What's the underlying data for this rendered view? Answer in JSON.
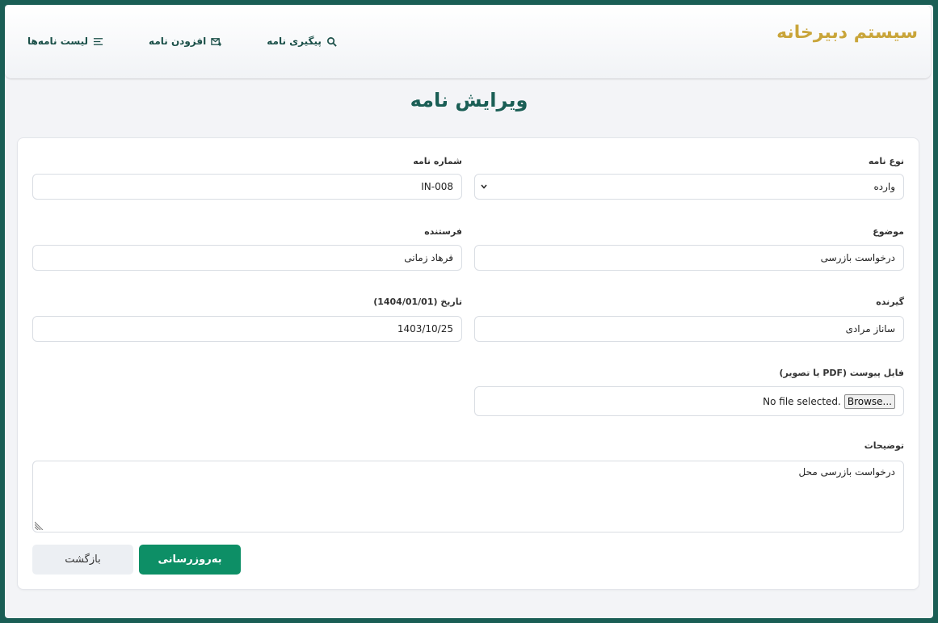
{
  "header": {
    "brand": "سیستم دبیرخانه",
    "nav": [
      {
        "label": "لیست نامه‌ها",
        "icon": "list-icon"
      },
      {
        "label": "افزودن نامه",
        "icon": "mail-plus-icon"
      },
      {
        "label": "پیگیری نامه",
        "icon": "search-icon"
      }
    ]
  },
  "page": {
    "title": "ویرایش نامه"
  },
  "form": {
    "letter_type": {
      "label": "نوع نامه",
      "value": "وارده"
    },
    "letter_number": {
      "label": "شماره نامه",
      "value": "IN-008"
    },
    "subject": {
      "label": "موضوع",
      "value": "درخواست بازرسی"
    },
    "sender": {
      "label": "فرستنده",
      "value": "فرهاد زمانی"
    },
    "recipient": {
      "label": "گیرنده",
      "value": "ساناز مرادی"
    },
    "date": {
      "label": "تاریخ (1404/01/01)",
      "value": "1403/10/25"
    },
    "attachment": {
      "label": "فایل پیوست (PDF یا تصویر)",
      "button": "Browse...",
      "status": "No file selected."
    },
    "description": {
      "label": "توضیحات",
      "value": "درخواست بازرسی محل"
    },
    "submit_label": "به‌روزرسانی",
    "back_label": "بازگشت"
  },
  "colors": {
    "accent": "#1a5e55",
    "brand": "#c9a53a",
    "primary_button": "#0d8f66"
  }
}
